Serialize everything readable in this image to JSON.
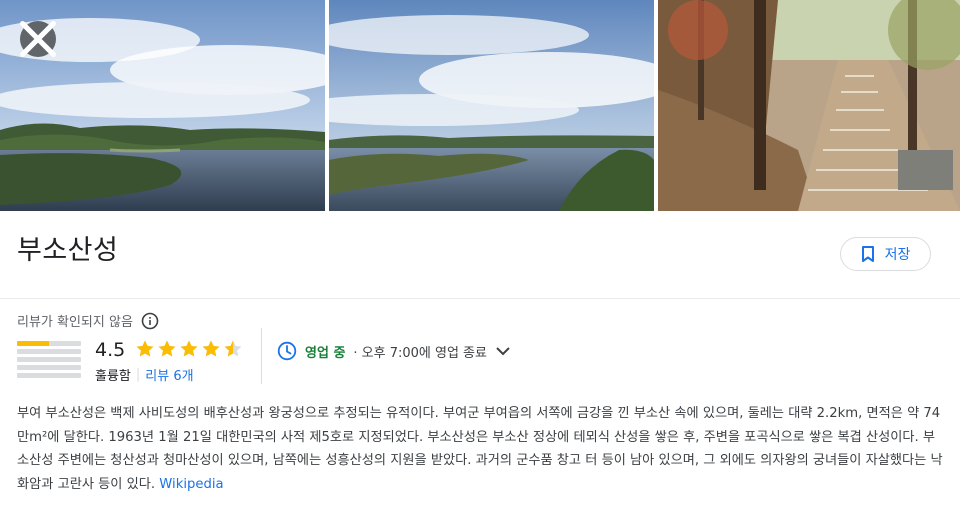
{
  "header": {
    "title": "부소산성",
    "save_label": "저장"
  },
  "photos": [
    {
      "icon": "landscape-river-photo"
    },
    {
      "icon": "landscape-river-photo"
    },
    {
      "icon": "forest-stairs-photo"
    }
  ],
  "rating": {
    "note": "리뷰가 확인되지 않음",
    "score": "4.5",
    "stars": 4.5,
    "label": "훌륭함",
    "separator": "|",
    "reviews_link": "리뷰 6개",
    "distribution": [
      0.5,
      0.0,
      0.0,
      0.0,
      0.0
    ]
  },
  "hours": {
    "status": "영업 중",
    "detail": "· 오후 7:00에 영업 종료"
  },
  "description": {
    "text": "부여 부소산성은 백제 사비도성의 배후산성과 왕궁성으로 추정되는 유적이다. 부여군 부여읍의 서쪽에 금강을 낀 부소산 속에 있으며, 둘레는 대략 2.2km, 면적은 약 74만m²에 달한다. 1963년 1월 21일 대한민국의 사적 제5호로 지정되었다. 부소산성은 부소산 정상에 테뫼식 산성을 쌓은 후, 주변을 포곡식으로 쌓은 복겹 산성이다. 부소산성 주변에는 청산성과 청마산성이 있으며, 남쪽에는 성흥산성의 지원을 받았다. 과거의 군수품 창고 터 등이 남아 있으며, 그 외에도 의자왕의 궁녀들이 자살했다는 낙화암과 고란사 등이 있다.",
    "source_link": "Wikipedia"
  },
  "colors": {
    "accent": "#1a73e8",
    "star": "#fbbc04",
    "open": "#188038"
  }
}
